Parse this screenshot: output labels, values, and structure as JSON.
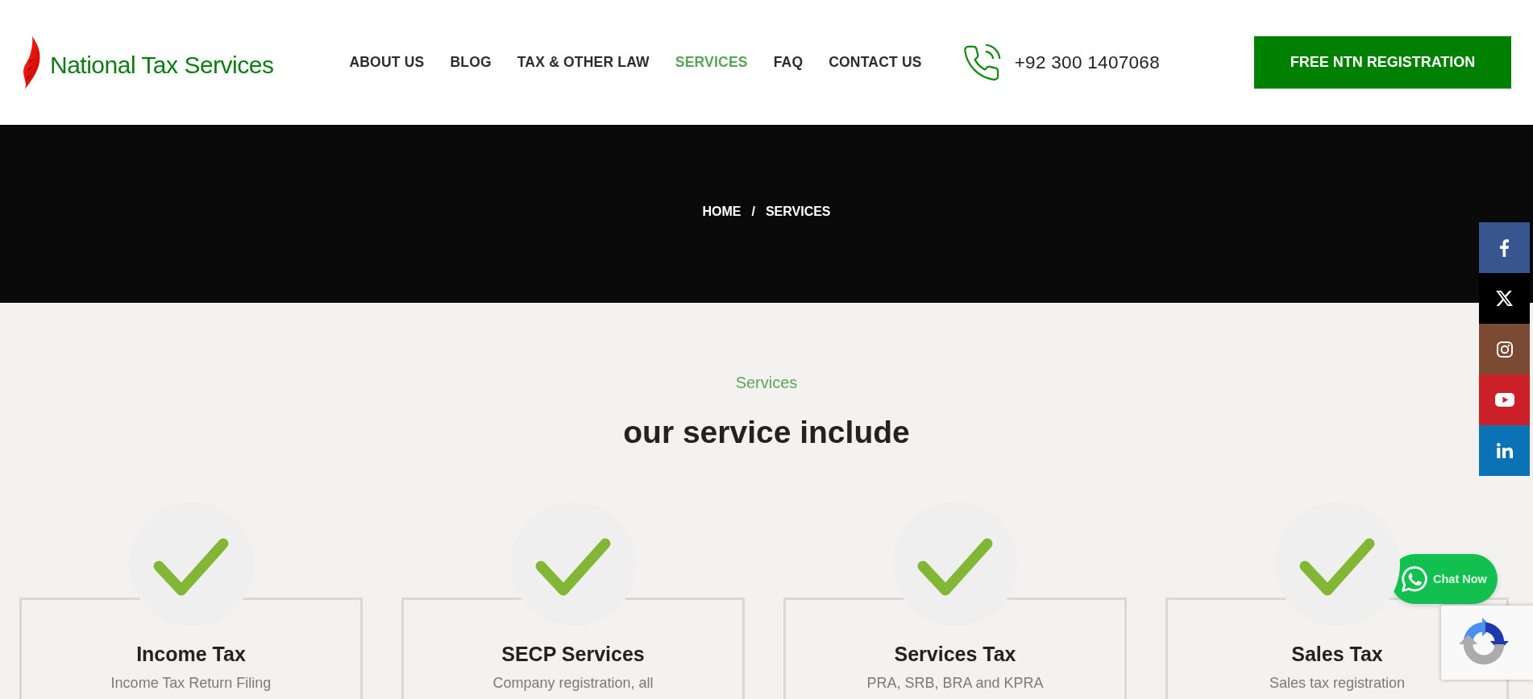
{
  "header": {
    "logo_text": "National Tax Services",
    "nav": [
      {
        "label": "ABOUT US",
        "selected": false
      },
      {
        "label": "BLOG",
        "selected": false
      },
      {
        "label": "TAX & OTHER LAW",
        "selected": false
      },
      {
        "label": "SERVICES",
        "selected": true
      },
      {
        "label": "FAQ",
        "selected": false
      },
      {
        "label": "CONTACT US",
        "selected": false
      }
    ],
    "phone": "+92 300 1407068",
    "cta_button": "FREE NTN REGISTRATION"
  },
  "banner": {
    "breadcrumb": [
      "HOME",
      "SERVICES"
    ],
    "separator": "/"
  },
  "section": {
    "eyebrow": "Services",
    "heading": "our service include",
    "cards": [
      {
        "title": "Income Tax",
        "description": "Income Tax Return Filing"
      },
      {
        "title": "SECP Services",
        "description": "Company registration, all"
      },
      {
        "title": "Services Tax",
        "description": "PRA, SRB, BRA and KPRA"
      },
      {
        "title": "Sales Tax",
        "description": "Sales tax registration"
      }
    ]
  },
  "social_bar": [
    {
      "kind": "facebook",
      "color": "#37558f"
    },
    {
      "kind": "x",
      "color": "#000000"
    },
    {
      "kind": "instagram",
      "color": "#7a4a33"
    },
    {
      "kind": "youtube",
      "color": "#cb2027"
    },
    {
      "kind": "linkedin",
      "color": "#0a72b5"
    }
  ],
  "chat_button": {
    "label": "Chat Now"
  }
}
